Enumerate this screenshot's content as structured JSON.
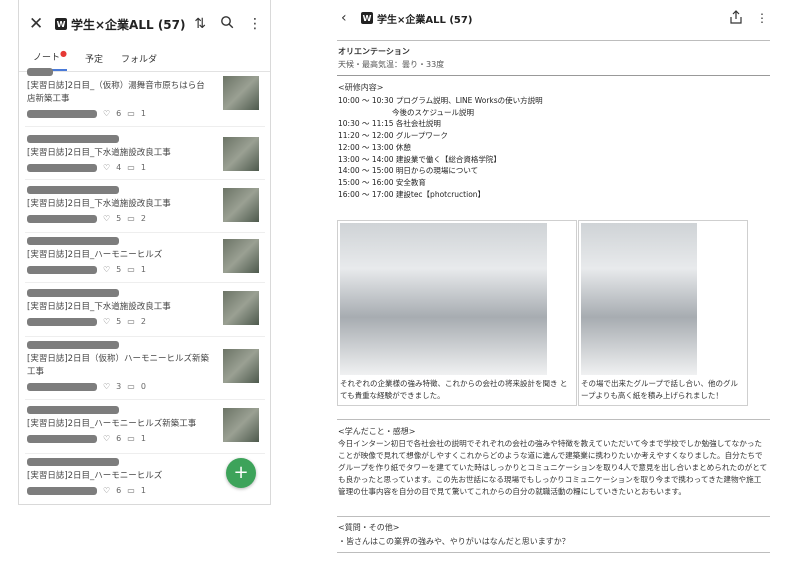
{
  "left": {
    "title": "学生×企業ALL (57)",
    "app_badge": "W",
    "tabs": [
      {
        "label": "ノート",
        "active": true,
        "dot": "●"
      },
      {
        "label": "予定",
        "active": false
      },
      {
        "label": "フォルダ",
        "active": false
      }
    ],
    "notes": [
      {
        "title": "[実習日誌]2日目_（仮称）湯舞音市原ちはら台店新築工事",
        "likes": "6",
        "comments": "1"
      },
      {
        "title": "[実習日誌]2日目_下水道施設改良工事",
        "likes": "4",
        "comments": "1"
      },
      {
        "title": "[実習日誌]2日目_下水道施設改良工事",
        "likes": "5",
        "comments": "2"
      },
      {
        "title": "[実習日誌]2日目_ハーモニーヒルズ",
        "likes": "5",
        "comments": "1"
      },
      {
        "title": "[実習日誌]2日目_下水道施設改良工事",
        "likes": "5",
        "comments": "2"
      },
      {
        "title": "[実習日誌]2日目（仮称）ハーモニーヒルズ新築工事",
        "likes": "3",
        "comments": "0"
      },
      {
        "title": "[実習日誌]2日目_ハーモニーヒルズ新築工事",
        "likes": "6",
        "comments": "1"
      },
      {
        "title": "[実習日誌]2日目_ハーモニーヒルズ",
        "likes": "6",
        "comments": "1"
      }
    ],
    "fab_label": "+"
  },
  "right": {
    "title": "学生×企業ALL (57)",
    "app_badge": "W",
    "section_title": "オリエンテーション",
    "weather": "天候・最高気温：曇り・33度",
    "training_heading": "<研修内容>",
    "schedule": [
      "10:00 ～ 10:30 プログラム説明、LINE Worksの使い方説明",
      "今後のスケジュール説明",
      "10:30 ～ 11:15 各社会社説明",
      "11:20 ～ 12:00 グループワーク",
      "12:00 ～ 13:00 休憩",
      "13:00 ～ 14:00 建設業で働く【総合資格学院】",
      "14:00 ～ 15:00 明日からの現場について",
      "15:00 ～ 16:00 安全教育",
      "16:00 ～ 17:00 建設tec【photcruction】"
    ],
    "captions": [
      "それぞれの企業様の強み特徴、これからの会社の将来設計を聞き とても貴重な経験ができました。",
      "その場で出来たグループで話し合い、他のグループよりも高く紙を積み上げられました！"
    ],
    "learned_heading": "<学んだこと・感想>",
    "learned_text": "今日インターン初日で各社会社の説明でそれぞれの会社の強みや特徴を教えていただいて今まで学校でしか勉強してなかったことが映像で見れて想像がしやすくこれからどのような道に進んで建築業に携わりたいか考えやすくなりました。自分たちでグループを作り紙でタワーを建てていた時はしっかりとコミュニケーションを取り4人で意見を出し合いまとめられたのがとても良かったと思っています。この先お世話になる現場でもしっかりコミュニケーションを取り今まで携わってきた建物や施工管理の仕事内容を自分の目で見て驚いてこれからの自分の就職活動の糧にしていきたいとおもいます。",
    "question_heading": "<質問・その他>",
    "question_text": "・皆さんはこの業界の強みや、やりがいはなんだと思いますか？"
  }
}
